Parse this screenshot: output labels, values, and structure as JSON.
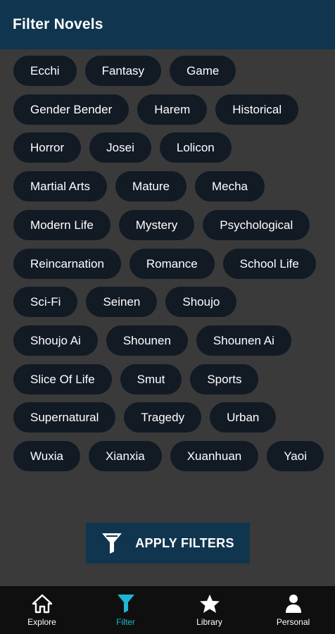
{
  "header": {
    "title": "Filter Novels"
  },
  "genres": [
    [
      "Ecchi",
      "Fantasy",
      "Game"
    ],
    [
      "Gender Bender",
      "Harem",
      "Historical"
    ],
    [
      "Horror",
      "Josei",
      "Lolicon"
    ],
    [
      "Martial Arts",
      "Mature",
      "Mecha"
    ],
    [
      "Modern Life",
      "Mystery",
      "Psychological"
    ],
    [
      "Reincarnation",
      "Romance",
      "School Life"
    ],
    [
      "Sci-Fi",
      "Seinen",
      "Shoujo"
    ],
    [
      "Shoujo Ai",
      "Shounen",
      "Shounen Ai"
    ],
    [
      "Slice Of Life",
      "Smut",
      "Sports"
    ],
    [
      "Supernatural",
      "Tragedy",
      "Urban"
    ],
    [
      "Wuxia",
      "Xianxia",
      "Xuanhuan",
      "Yaoi"
    ]
  ],
  "apply_button": {
    "label": "APPLY FILTERS",
    "icon": "funnel-icon"
  },
  "bottom_nav": {
    "items": [
      {
        "label": "Explore",
        "icon": "home-icon",
        "active": false
      },
      {
        "label": "Filter",
        "icon": "funnel-icon",
        "active": true
      },
      {
        "label": "Library",
        "icon": "star-icon",
        "active": false
      },
      {
        "label": "Personal",
        "icon": "person-icon",
        "active": false
      }
    ]
  },
  "colors": {
    "background": "#3a3a3a",
    "header": "#10354f",
    "chip": "#121a24",
    "accent": "#1fb6d6",
    "nav_background": "#0f0f0f"
  }
}
